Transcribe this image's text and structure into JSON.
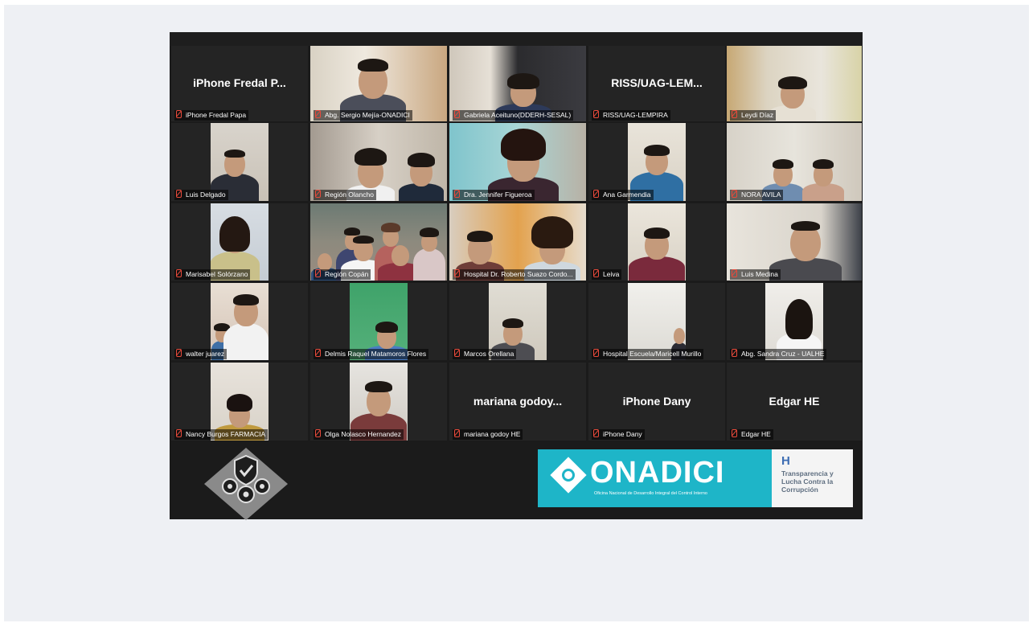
{
  "meeting": {
    "colors": {
      "background": "#1b1b1b",
      "active_speaker_border": "#c6e05a",
      "muted_icon": "#e74a3b"
    },
    "tiles": [
      {
        "label": "iPhone Fredal Papa",
        "display_text": "iPhone Fredal P...",
        "video": false,
        "muted": true
      },
      {
        "label": "Abg. Sergio Mejía-ONADICI",
        "video": true,
        "muted": true,
        "active_speaker": true
      },
      {
        "label": "Gabriela Aceituno(DDERH-SESAL)",
        "video": true,
        "muted": true
      },
      {
        "label": "RISS/UAG-LEMPIRA",
        "display_text": "RISS/UAG-LEM...",
        "video": false,
        "muted": true
      },
      {
        "label": "Leydi Díaz",
        "video": true,
        "muted": true
      },
      {
        "label": "Luis Delgado",
        "video": true,
        "muted": true
      },
      {
        "label": "Región Olancho",
        "video": true,
        "muted": true
      },
      {
        "label": "Dra. Jennifer Figueroa",
        "video": true,
        "muted": true
      },
      {
        "label": "Ana Garmendia",
        "video": true,
        "muted": true
      },
      {
        "label": "NORA AVILA",
        "video": true,
        "muted": true
      },
      {
        "label": "Marisabel Solórzano",
        "video": true,
        "muted": true
      },
      {
        "label": "Región Copán",
        "video": true,
        "muted": true
      },
      {
        "label": "Hospital Dr. Roberto Suazo Cordo...",
        "video": true,
        "muted": true
      },
      {
        "label": "Leiva",
        "video": true,
        "muted": true
      },
      {
        "label": "Luis Medina",
        "video": true,
        "muted": true
      },
      {
        "label": "walter juarez",
        "video": true,
        "muted": true
      },
      {
        "label": "Delmis Raquel Matamoros Flores",
        "video": true,
        "muted": true
      },
      {
        "label": "Marcos Orellana",
        "video": true,
        "muted": true
      },
      {
        "label": "Hospital Escuela/Maricell Murillo",
        "video": true,
        "muted": true
      },
      {
        "label": "Abg. Sandra Cruz - UALHE",
        "video": true,
        "muted": true
      },
      {
        "label": "Nancy Burgos FARMACIA",
        "video": true,
        "muted": true
      },
      {
        "label": "Olga Nolasco Hernandez",
        "video": true,
        "muted": true
      },
      {
        "label": "mariana godoy HE",
        "display_text": "mariana godoy...",
        "video": false,
        "muted": true
      },
      {
        "label": "iPhone Dany",
        "display_text": "iPhone Dany",
        "video": false,
        "muted": true
      },
      {
        "label": "Edgar HE",
        "display_text": "Edgar HE",
        "video": false,
        "muted": true
      }
    ]
  },
  "footer": {
    "emblem_icon": "shield-gears-emblem-icon",
    "onadici": {
      "name": "ONADICI",
      "subtitle": "Oficina Nacional de Desarrollo Integral del Control Interno",
      "color": "#1eb5c8"
    },
    "partner": {
      "mark": "H",
      "text": "Transparencia y Lucha Contra la Corrupción"
    }
  }
}
